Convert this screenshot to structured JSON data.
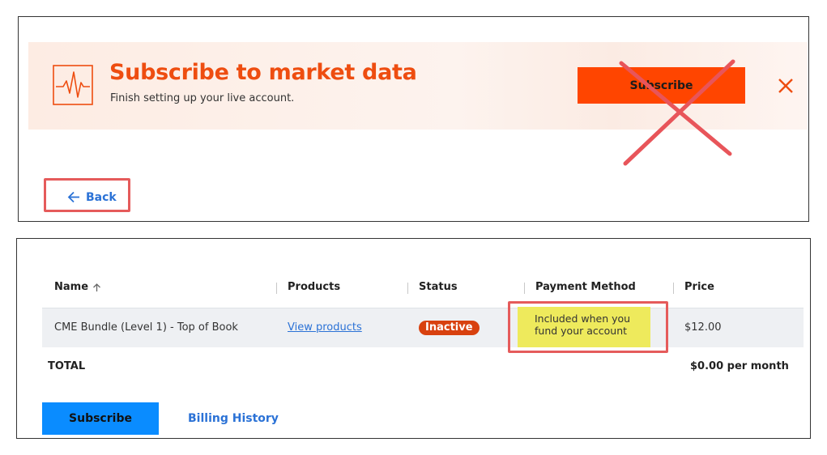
{
  "banner": {
    "title": "Subscribe to market data",
    "subtitle": "Finish setting up your live account.",
    "subscribe_label": "Subscribe",
    "icon": "pulse-icon",
    "close_icon": "close-icon",
    "accent_color": "#ee4d10",
    "button_color": "#ff4500"
  },
  "nav": {
    "back_label": "Back",
    "back_icon": "arrow-left-icon"
  },
  "table": {
    "columns": [
      "Name",
      "Products",
      "Status",
      "Payment Method",
      "Price"
    ],
    "sort_icon": "arrow-up-icon",
    "rows": [
      {
        "name": "CME Bundle (Level 1) - Top of Book",
        "products": "View products",
        "status": "Inactive",
        "payment_method_line1": "Included when you",
        "payment_method_line2": "fund your account",
        "price": "$12.00"
      }
    ],
    "total_label": "TOTAL",
    "total_value": "$0.00 per month"
  },
  "actions": {
    "subscribe_label": "Subscribe",
    "billing_history_label": "Billing History"
  },
  "colors": {
    "link": "#2b72d6",
    "status_inactive": "#d8410f",
    "primary_button": "#0a8cff",
    "annotation_highlight": "#e55b5b",
    "note_highlight": "#eeea5c"
  }
}
